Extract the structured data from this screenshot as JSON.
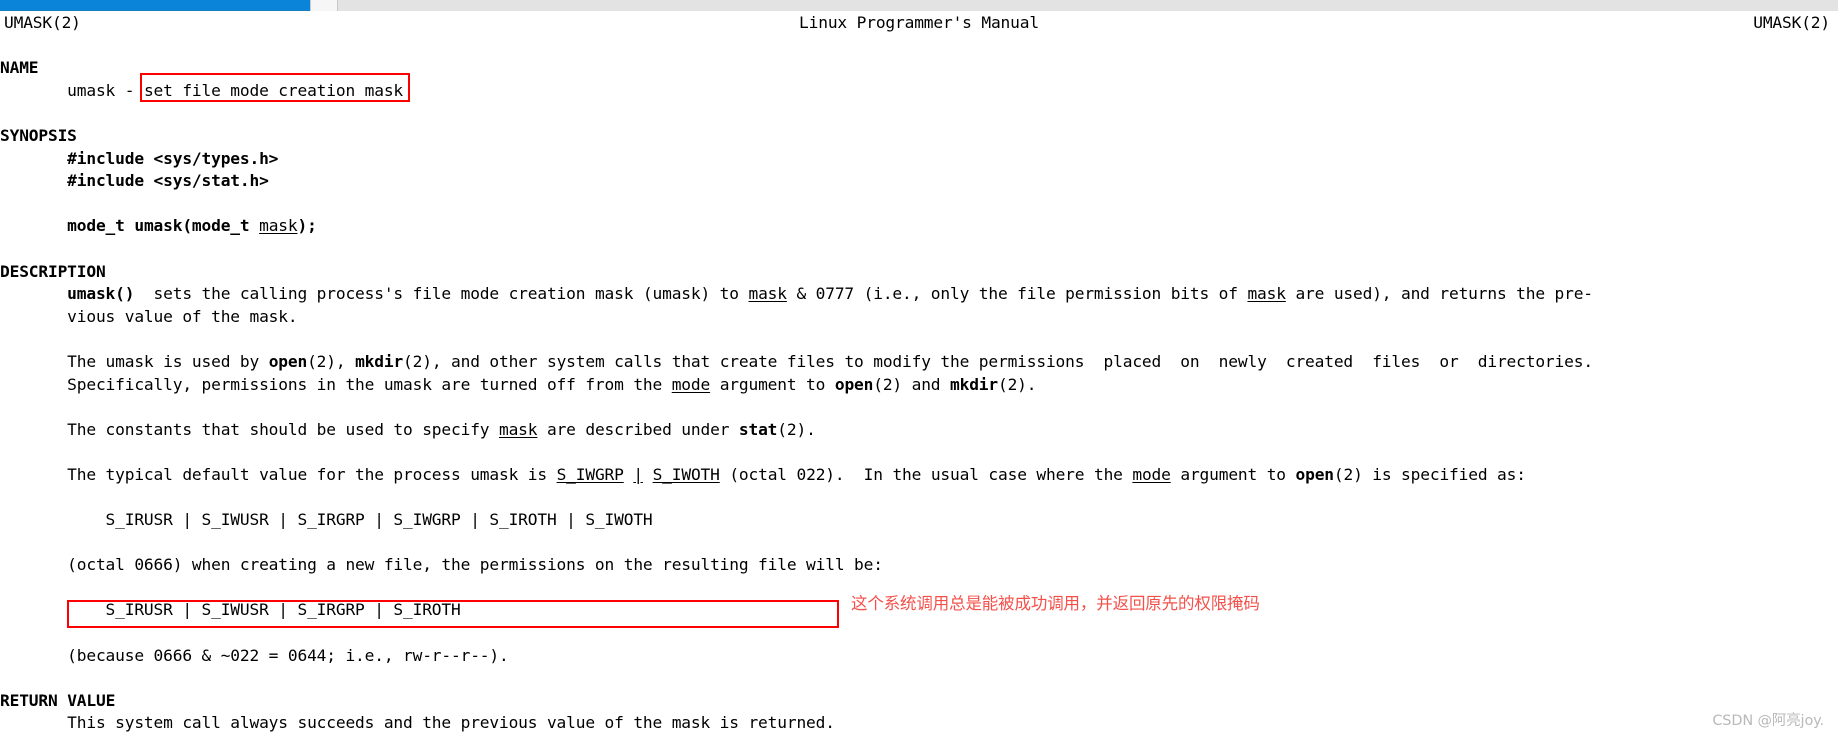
{
  "window": {
    "titlebar_text": "",
    "accent_color": "#0a84d8",
    "tabstrip_color": "#e3e3e3"
  },
  "man": {
    "header": {
      "left": "UMASK(2)",
      "center": "Linux Programmer's Manual",
      "right": "UMASK(2)"
    },
    "sections": {
      "name": "NAME",
      "synopsis": "SYNOPSIS",
      "description": "DESCRIPTION",
      "return_value_part1": "RETURN",
      "return_value_part2": "VALUE"
    },
    "name_body_prefix": "       umask - ",
    "name_body_highlight": "set file mode creation mask",
    "synopsis": {
      "include_types": "       #include <sys/types.h>",
      "include_stat": "       #include <sys/stat.h>",
      "prototype_pre": "       ",
      "prototype_bold1": "mode_t umask(mode_t ",
      "prototype_underline": "mask",
      "prototype_bold2": ");"
    },
    "description": {
      "p1_a": "       ",
      "p1_b": "umask()",
      "p1_c": "  sets the calling process's file mode creation mask (umask) to ",
      "p1_d": "mask",
      "p1_e": " & 0777 (i.e., only the file permission bits of ",
      "p1_f": "mask",
      "p1_g": " are used), and returns the pre-",
      "p1_cont": "       vious value of the mask.",
      "p2_a": "       The umask is used by ",
      "p2_open": "open",
      "p2_b": "(2), ",
      "p2_mkdir": "mkdir",
      "p2_c": "(2), and other system calls that create files to modify the permissions  placed  on  newly  created  files  or  directories.",
      "p2_l2_a": "       Specifically, permissions in the umask are turned off from the ",
      "p2_l2_mode": "mode",
      "p2_l2_b": " argument to ",
      "p2_l2_open": "open",
      "p2_l2_c": "(2) and ",
      "p2_l2_mkdir": "mkdir",
      "p2_l2_d": "(2).",
      "p3_a": "       The constants that should be used to specify ",
      "p3_mask": "mask",
      "p3_b": " are described under ",
      "p3_stat": "stat",
      "p3_c": "(2).",
      "p4_a": "       The typical default value for the process umask is ",
      "p4_u1": "S_IWGRP",
      "p4_b": " ",
      "p4_pipe": "|",
      "p4_c": " ",
      "p4_u2": "S_IWOTH",
      "p4_d": " (octal 022).  In the usual case where the ",
      "p4_mode": "mode",
      "p4_e": " argument to ",
      "p4_open": "open",
      "p4_f": "(2) is specified as:",
      "flags_line_1": "           S_IRUSR | S_IWUSR | S_IRGRP | S_IWGRP | S_IROTH | S_IWOTH",
      "p5": "       (octal 0666) when creating a new file, the permissions on the resulting file will be:",
      "flags_line_2": "           S_IRUSR | S_IWUSR | S_IRGRP | S_IROTH",
      "p6": "       (because 0666 & ~022 = 0644; i.e., rw-r--r--)."
    },
    "return_value_body": "       This system call always succeeds and the previous value of the mask is returned."
  },
  "annotations": {
    "chinese_note": "这个系统调用总是能被成功调用，并返回原先的权限掩码",
    "box_color": "#ff0000",
    "note_color": "#f4504a"
  },
  "watermark": {
    "text": "CSDN @阿亮joy.",
    "color": "#b9b9b9"
  }
}
